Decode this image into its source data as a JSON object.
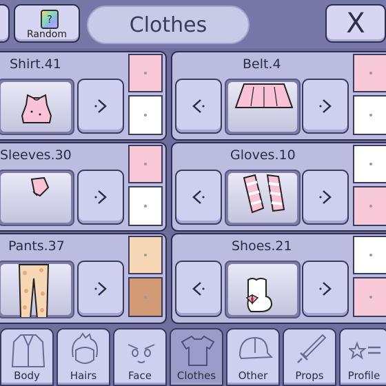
{
  "header": {
    "title": "Clothes",
    "random_label": "Random",
    "random_glyph": "?",
    "close_glyph": "X"
  },
  "categories": {
    "shirt": {
      "label": "Shirt.41",
      "color1": "#f7c8d8",
      "color2": "#ffffff"
    },
    "belt": {
      "label": "Belt.4",
      "color1": "#f7c8d8",
      "color2": "#ffffff"
    },
    "sleeves": {
      "label": "Sleeves.30",
      "color1": "#f7c8d8",
      "color2": "#ffffff"
    },
    "gloves": {
      "label": "Gloves.10",
      "color1": "#ffffff",
      "color2": "#f7c8d8"
    },
    "pants": {
      "label": "Pants.37",
      "color1": "#f5d7b6",
      "color2": "#d39a76"
    },
    "shoes": {
      "label": "Shoes.21",
      "color1": "#ffffff",
      "color2": "#f7c8d8"
    }
  },
  "nav": {
    "body": "Body",
    "hairs": "Hairs",
    "face": "Face",
    "clothes": "Clothes",
    "other": "Other",
    "props": "Props",
    "profile": "Profile"
  },
  "icons": {
    "prev": "chevron-left-icon",
    "next": "chevron-right-icon",
    "close": "close-icon"
  },
  "colors": {
    "background": "#6e6e9c",
    "panel": "#bcbce0",
    "outline": "#2d2d4e"
  }
}
